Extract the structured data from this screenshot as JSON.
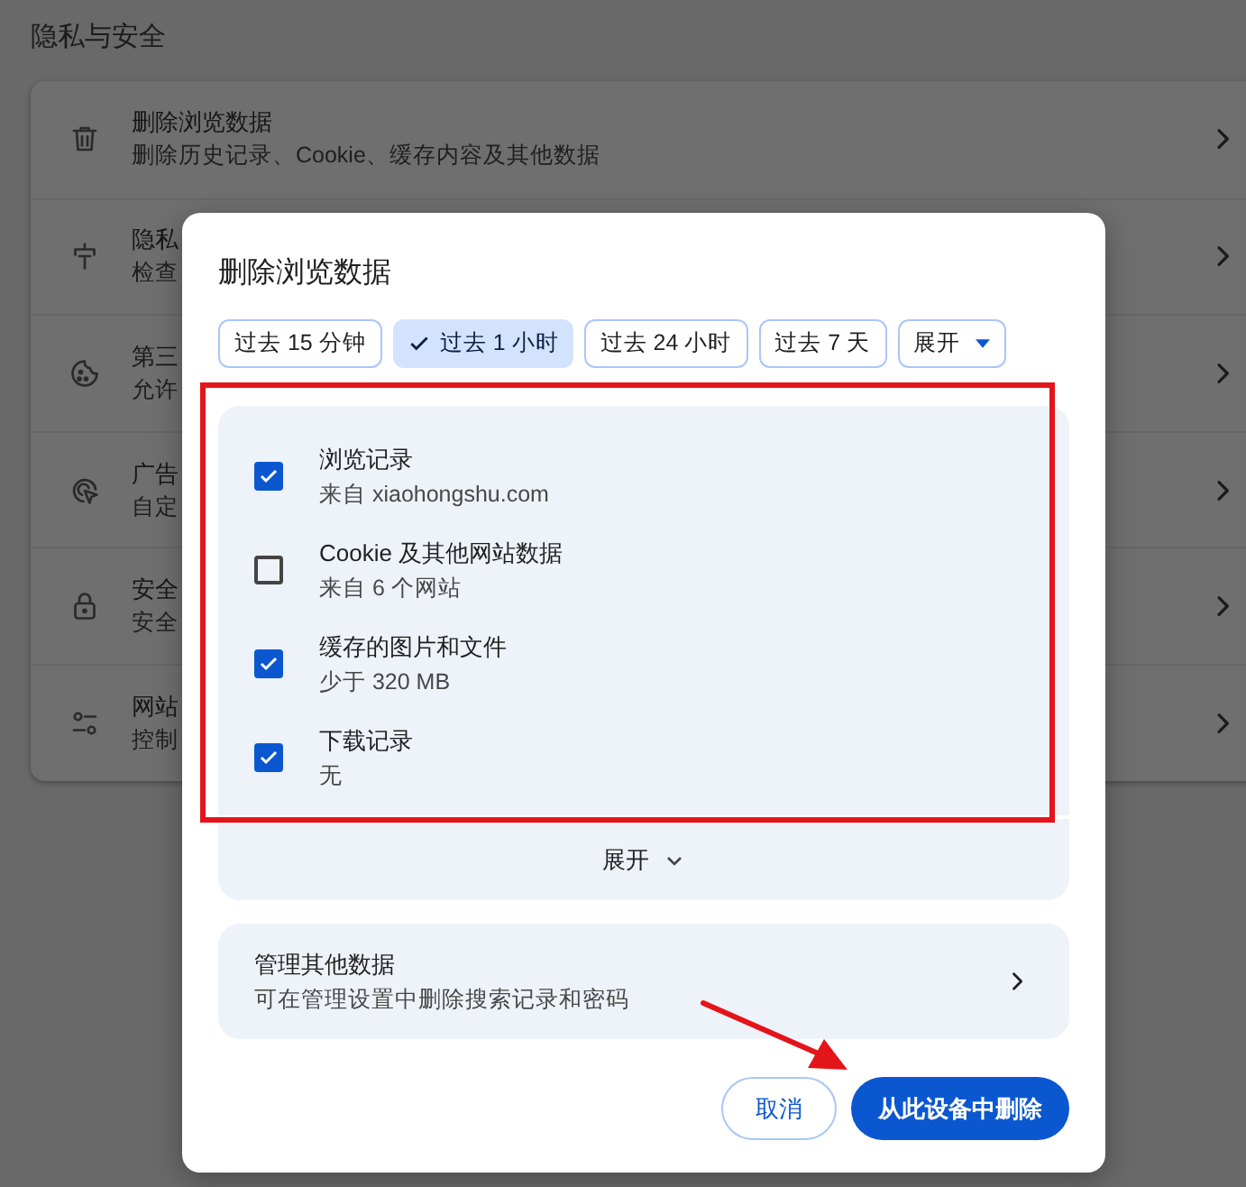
{
  "page": {
    "heading": "隐私与安全",
    "rows": [
      {
        "title": "删除浏览数据",
        "subtitle": "删除历史记录、Cookie、缓存内容及其他数据"
      },
      {
        "title": "隐私",
        "subtitle": "检查"
      },
      {
        "title": "第三",
        "subtitle": "允许"
      },
      {
        "title": "广告",
        "subtitle": "自定"
      },
      {
        "title": "安全",
        "subtitle": "安全"
      },
      {
        "title": "网站",
        "subtitle": "控制"
      }
    ]
  },
  "dialog": {
    "title": "删除浏览数据",
    "ranges": [
      {
        "label": "过去 15 分钟",
        "selected": false
      },
      {
        "label": "过去 1 小时",
        "selected": true
      },
      {
        "label": "过去 24 小时",
        "selected": false
      },
      {
        "label": "过去 7 天",
        "selected": false
      }
    ],
    "more_dropdown": "展开",
    "items": [
      {
        "title": "浏览记录",
        "subtitle": "来自 xiaohongshu.com",
        "checked": true
      },
      {
        "title": "Cookie 及其他网站数据",
        "subtitle": "来自 6 个网站",
        "checked": false
      },
      {
        "title": "缓存的图片和文件",
        "subtitle": "少于 320 MB",
        "checked": true
      },
      {
        "title": "下载记录",
        "subtitle": "无",
        "checked": true
      }
    ],
    "expand_label": "展开",
    "manage": {
      "title": "管理其他数据",
      "subtitle": "可在管理设置中删除搜索记录和密码"
    },
    "cancel_button": "取消",
    "confirm_button": "从此设备中删除"
  }
}
